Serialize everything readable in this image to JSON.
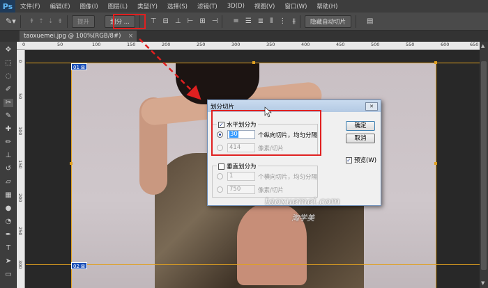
{
  "app": {
    "logo": "Ps"
  },
  "menu": [
    "文件(F)",
    "编辑(E)",
    "图像(I)",
    "图层(L)",
    "类型(Y)",
    "选择(S)",
    "滤镜(T)",
    "3D(D)",
    "视图(V)",
    "窗口(W)",
    "帮助(H)"
  ],
  "options": {
    "promote_label": "提升",
    "divide_label": "划分 ...",
    "hide_auto_slices_label": "隐藏自动切片"
  },
  "document": {
    "tab_title": "taoxuemei.jpg @ 100%(RGB/8#)",
    "close_glyph": "×"
  },
  "ruler_top": [
    "0",
    "50",
    "100",
    "150",
    "200",
    "250",
    "300",
    "350",
    "400",
    "450",
    "500",
    "550",
    "600",
    "650"
  ],
  "ruler_left": [
    "0",
    "50",
    "100",
    "150",
    "200",
    "250",
    "300"
  ],
  "slices": {
    "top_badge": "01 ⊠",
    "bottom_badge": "02 ⊠"
  },
  "dialog": {
    "title": "划分切片",
    "horizontal": {
      "label": "水平划分为",
      "checked": true,
      "count_value": "30",
      "count_label": "个纵向切片，均匀分隔",
      "pixel_value": "414",
      "pixel_label": "像素/切片"
    },
    "vertical": {
      "label": "垂直划分为",
      "checked": false,
      "count_value": "1",
      "count_label": "个横向切片，均匀分隔",
      "pixel_value": "750",
      "pixel_label": "像素/切片"
    },
    "ok_label": "确定",
    "cancel_label": "取消",
    "preview_label": "预览(W)",
    "preview_checked": true
  },
  "watermark": {
    "line1": "taoxuemei.com",
    "line2": "淘学美"
  },
  "colors": {
    "highlight": "#e02020",
    "slice_line": "#e0a020",
    "slice_badge": "#1a4fb8"
  }
}
